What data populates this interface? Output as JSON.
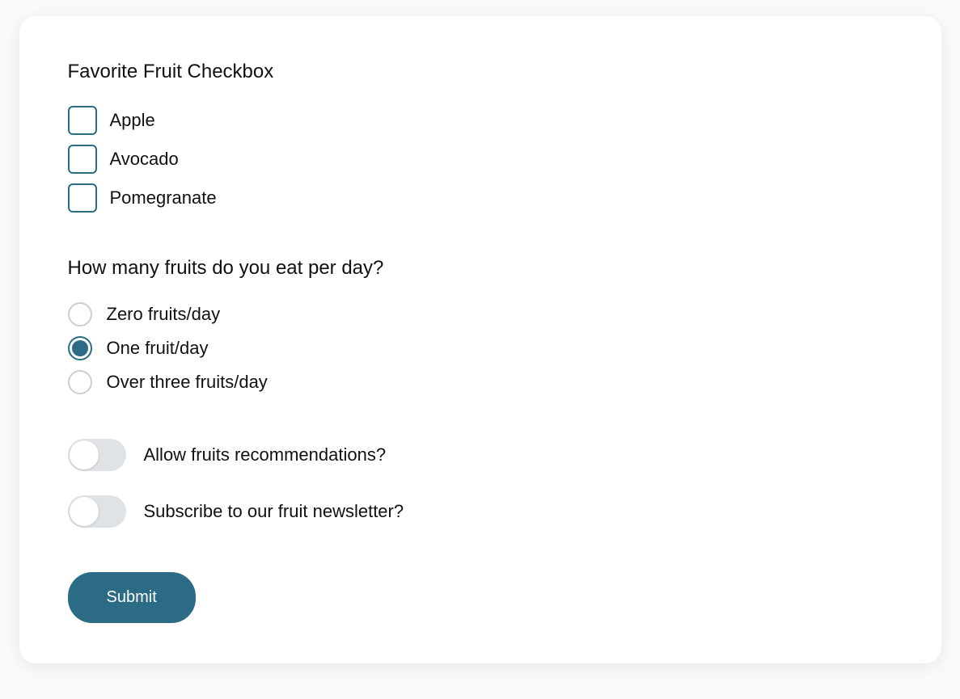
{
  "colors": {
    "accent": "#2b6b85"
  },
  "checkbox": {
    "title": "Favorite Fruit Checkbox",
    "items": [
      {
        "label": "Apple",
        "checked": false
      },
      {
        "label": "Avocado",
        "checked": false
      },
      {
        "label": "Pomegranate",
        "checked": false
      }
    ]
  },
  "radio": {
    "title": "How many fruits do you eat per day?",
    "items": [
      {
        "label": "Zero fruits/day",
        "selected": false
      },
      {
        "label": "One fruit/day",
        "selected": true
      },
      {
        "label": "Over three fruits/day",
        "selected": false
      }
    ]
  },
  "toggles": {
    "items": [
      {
        "label": "Allow fruits recommendations?",
        "on": false
      },
      {
        "label": "Subscribe to our fruit newsletter?",
        "on": false
      }
    ]
  },
  "submit": {
    "label": "Submit"
  }
}
